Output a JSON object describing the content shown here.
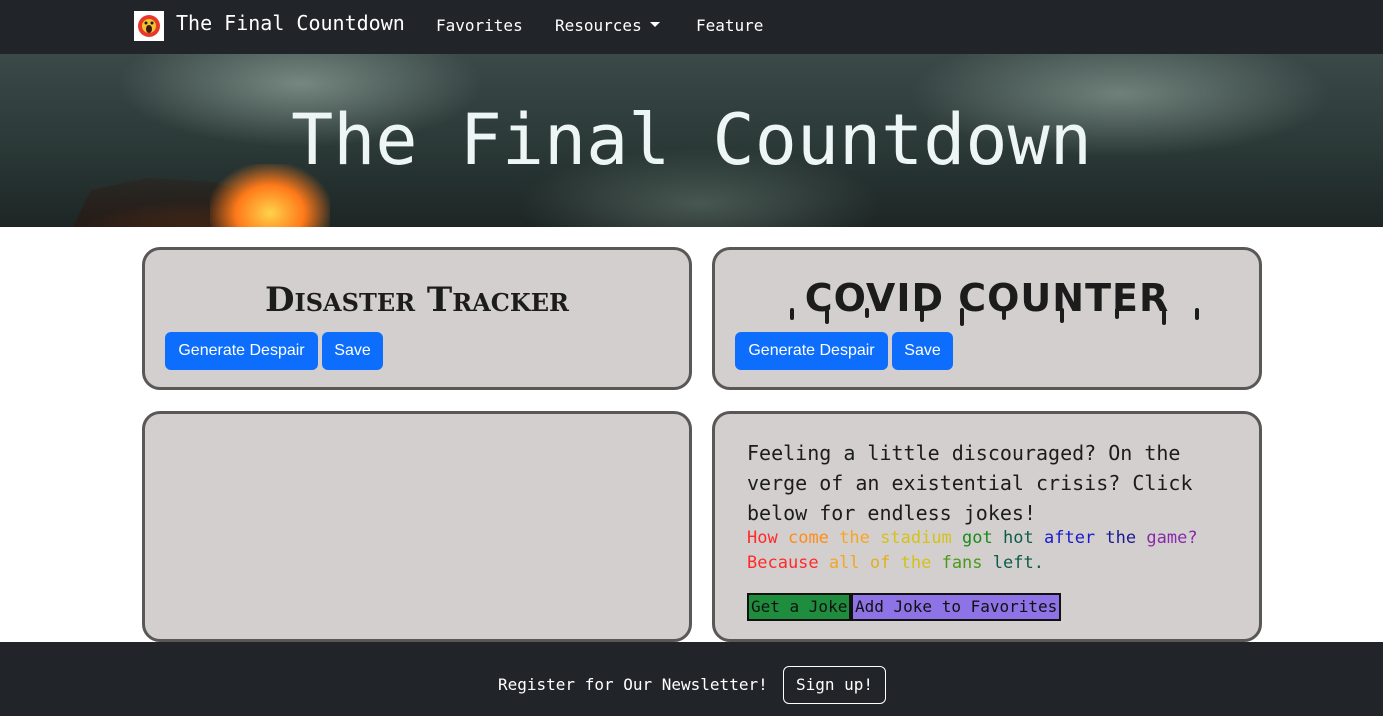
{
  "nav": {
    "brand": "The Final Countdown",
    "logo_icon": "scream-face-icon",
    "links": [
      "Favorites",
      "Resources",
      "Feature"
    ]
  },
  "hero": {
    "title": "The Final Countdown"
  },
  "disaster": {
    "title": "Disaster Tracker",
    "generate_label": "Generate Despair",
    "save_label": "Save"
  },
  "covid": {
    "title": "COVID COUNTER",
    "generate_label": "Generate Despair",
    "save_label": "Save"
  },
  "joke": {
    "intro": "Feeling a little discouraged? On the verge of an existential crisis? Click below for endless jokes!",
    "question_words": [
      "How",
      "come",
      "the",
      "stadium",
      "got",
      "hot",
      "after",
      "the",
      "game?"
    ],
    "answer_words": [
      "Because",
      "all",
      "of",
      "the",
      "fans",
      "left."
    ],
    "get_label": "Get a Joke",
    "fav_label": "Add Joke to Favorites"
  },
  "footer": {
    "text": "Register for Our Newsletter!",
    "signup_label": "Sign up!"
  },
  "colors": {
    "nav_bg": "#212529",
    "primary": "#0d6efd",
    "card_bg": "#d3cfcf",
    "joke_get_bg": "#1e8e3e",
    "joke_fav_bg": "#8d73e6"
  }
}
